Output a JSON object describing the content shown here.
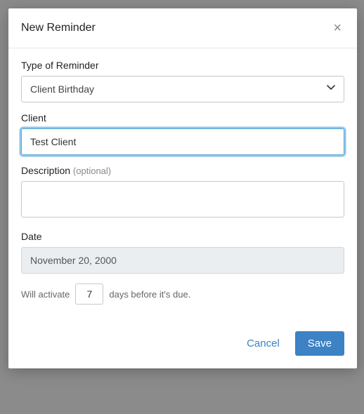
{
  "modal": {
    "title": "New Reminder",
    "fields": {
      "type": {
        "label": "Type of Reminder",
        "selected": "Client Birthday"
      },
      "client": {
        "label": "Client",
        "value": "Test Client"
      },
      "description": {
        "label": "Description",
        "optional_hint": "(optional)",
        "value": ""
      },
      "date": {
        "label": "Date",
        "value": "November 20, 2000"
      },
      "activate": {
        "prefix": "Will activate",
        "days": "7",
        "suffix": "days before it's due."
      }
    },
    "buttons": {
      "cancel": "Cancel",
      "save": "Save"
    }
  }
}
